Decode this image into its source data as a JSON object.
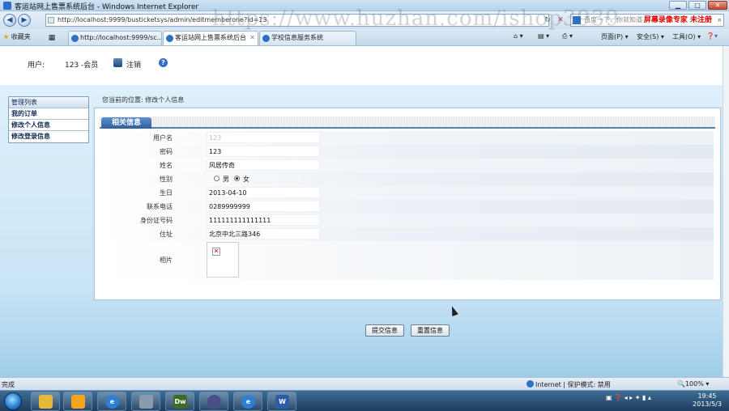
{
  "window": {
    "title": "客运站网上售票系统后台 - Windows Internet Explorer"
  },
  "browser": {
    "address": "http://localhost:9999/busticketsys/admin/editmemberone?id=13",
    "search_hint": "百度一下，你就知道",
    "promo": "屏幕录像专家  未注册",
    "favorites": "收藏夹",
    "tabs": [
      {
        "label": "http://localhost:9999/sc...",
        "active": false
      },
      {
        "label": "客运站网上售票系统后台",
        "active": true
      },
      {
        "label": "学校信息服务系统",
        "active": false
      }
    ],
    "commands": {
      "page": "页面(P)",
      "safety": "安全(S)",
      "tools": "工具(O)"
    }
  },
  "userbar": {
    "user_label": "用户:",
    "user_value": "123 -会员",
    "logout": "注销"
  },
  "menu": {
    "header": "管理列表",
    "items": [
      "我的订单",
      "修改个人信息",
      "修改登录信息"
    ]
  },
  "breadcrumb": "您当前的位置: 修改个人信息",
  "form": {
    "title": "相关信息",
    "username_label": "用户名",
    "username_value": "123",
    "password_label": "密码",
    "password_value": "123",
    "name_label": "姓名",
    "name_value": "风居传奇",
    "gender_label": "性别",
    "gender_male": "男",
    "gender_female": "女",
    "gender_selected": "女",
    "birthday_label": "生日",
    "birthday_value": "2013-04-10",
    "phone_label": "联系电话",
    "phone_value": "0289999999",
    "idcard_label": "身份证号码",
    "idcard_value": "111111111111111",
    "address_label": "住址",
    "address_value": "北京中北三路346",
    "photo_label": "相片",
    "submit": "提交信息",
    "reset": "重置信息"
  },
  "status": {
    "left": "完成",
    "zone": "Internet | 保护模式: 禁用",
    "zoom": "100%"
  },
  "taskbar": {
    "clock_time": "19:45",
    "clock_date": "2013/5/3"
  },
  "watermark": "https://www.huzhan.com/ishop3939"
}
